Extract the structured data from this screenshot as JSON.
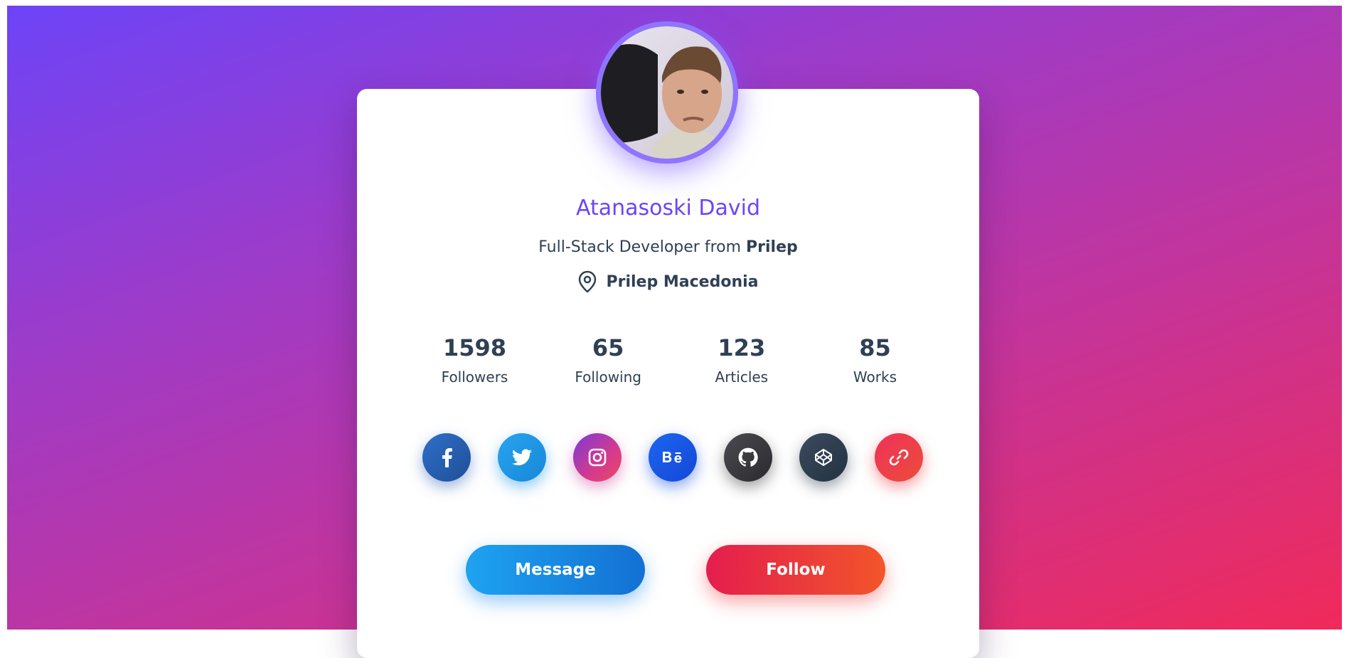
{
  "profile": {
    "name": "Atanasoski David",
    "subtitle_prefix": "Full-Stack Developer from",
    "subtitle_city": "Prilep",
    "location": "Prilep Macedonia"
  },
  "stats": [
    {
      "value": "1598",
      "label": "Followers"
    },
    {
      "value": "65",
      "label": "Following"
    },
    {
      "value": "123",
      "label": "Articles"
    },
    {
      "value": "85",
      "label": "Works"
    }
  ],
  "socials": [
    {
      "icon": "facebook-icon",
      "color": "#2d64b8"
    },
    {
      "icon": "twitter-icon",
      "color": "#1f95e6"
    },
    {
      "icon": "instagram-icon",
      "color": "#c03aa0"
    },
    {
      "icon": "behance-icon",
      "color": "#1b57e8"
    },
    {
      "icon": "github-icon",
      "color": "#3b3b3f"
    },
    {
      "icon": "codepen-icon",
      "color": "#2f3e4e"
    },
    {
      "icon": "link-icon",
      "color": "#ee3b4a"
    }
  ],
  "buttons": {
    "message_label": "Message",
    "follow_label": "Follow"
  },
  "colors": {
    "accent": "#6d44f7",
    "text": "#2f4055",
    "bg_start": "#6d44f7",
    "bg_end": "#f02a5a"
  }
}
